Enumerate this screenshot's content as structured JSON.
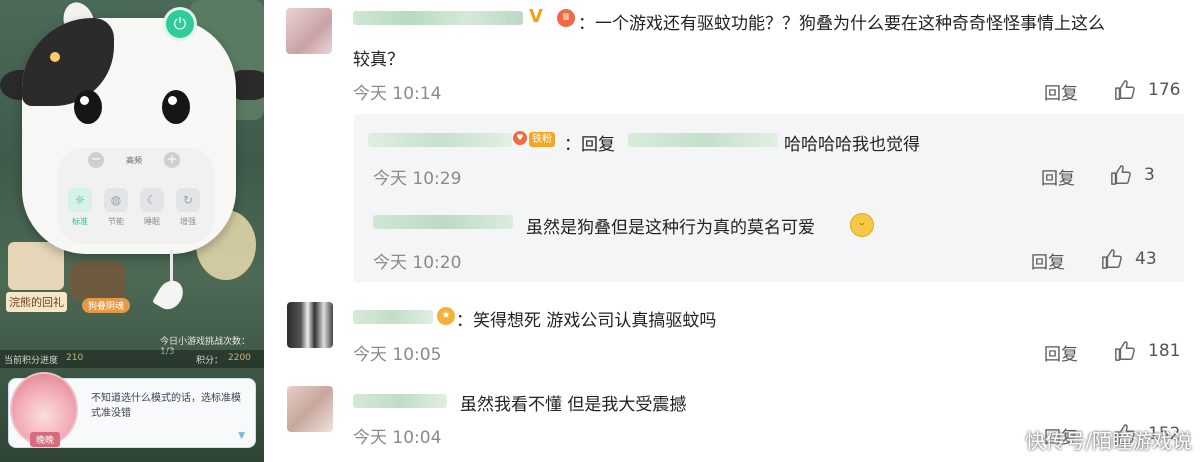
{
  "game_panel": {
    "mode_level_label": "高频",
    "modes": [
      {
        "label": "标准",
        "icon": "sun-icon",
        "active": true
      },
      {
        "label": "节能",
        "icon": "bulb-icon",
        "active": false
      },
      {
        "label": "睡眠",
        "icon": "moon-icon",
        "active": false
      },
      {
        "label": "增强",
        "icon": "boost-icon",
        "active": false
      }
    ],
    "gift_label": "浣熊的回礼",
    "tag_label": "狗叠阴魂",
    "game_count_text": "今日小游戏挑战次数：1/3",
    "progress_label": "当前积分进度",
    "progress_value": "210",
    "score_label": "积分：",
    "score_value": "2200",
    "dialog_text": "不知道选什么模式的话，选标准模式准没错",
    "speaker_name": "晚晚"
  },
  "comments": [
    {
      "text_line1": "：一个游戏还有驱蚊功能？？狗叠为什么要在这种奇奇怪怪事情上这么",
      "text_line2": "较真？",
      "time": "今天 10:14",
      "reply_label": "回复",
      "likes": "176"
    },
    {
      "text_fan_badge": "铁粉",
      "text_prefix": "：回复",
      "text_suffix": "哈哈哈哈我也觉得",
      "time": "今天 10:29",
      "reply_label": "回复",
      "likes": "3"
    },
    {
      "text": "虽然是狗叠但是这种行为真的莫名可爱",
      "time": "今天 10:20",
      "reply_label": "回复",
      "likes": "43"
    },
    {
      "text": "：笑得想死 游戏公司认真搞驱蚊吗",
      "time": "今天 10:05",
      "reply_label": "回复",
      "likes": "181"
    },
    {
      "text": "虽然我看不懂  但是我大受震撼",
      "time": "今天 10:04",
      "reply_label": "回复",
      "likes": "152"
    }
  ],
  "watermark": "快传号/陌瞳游戏说"
}
